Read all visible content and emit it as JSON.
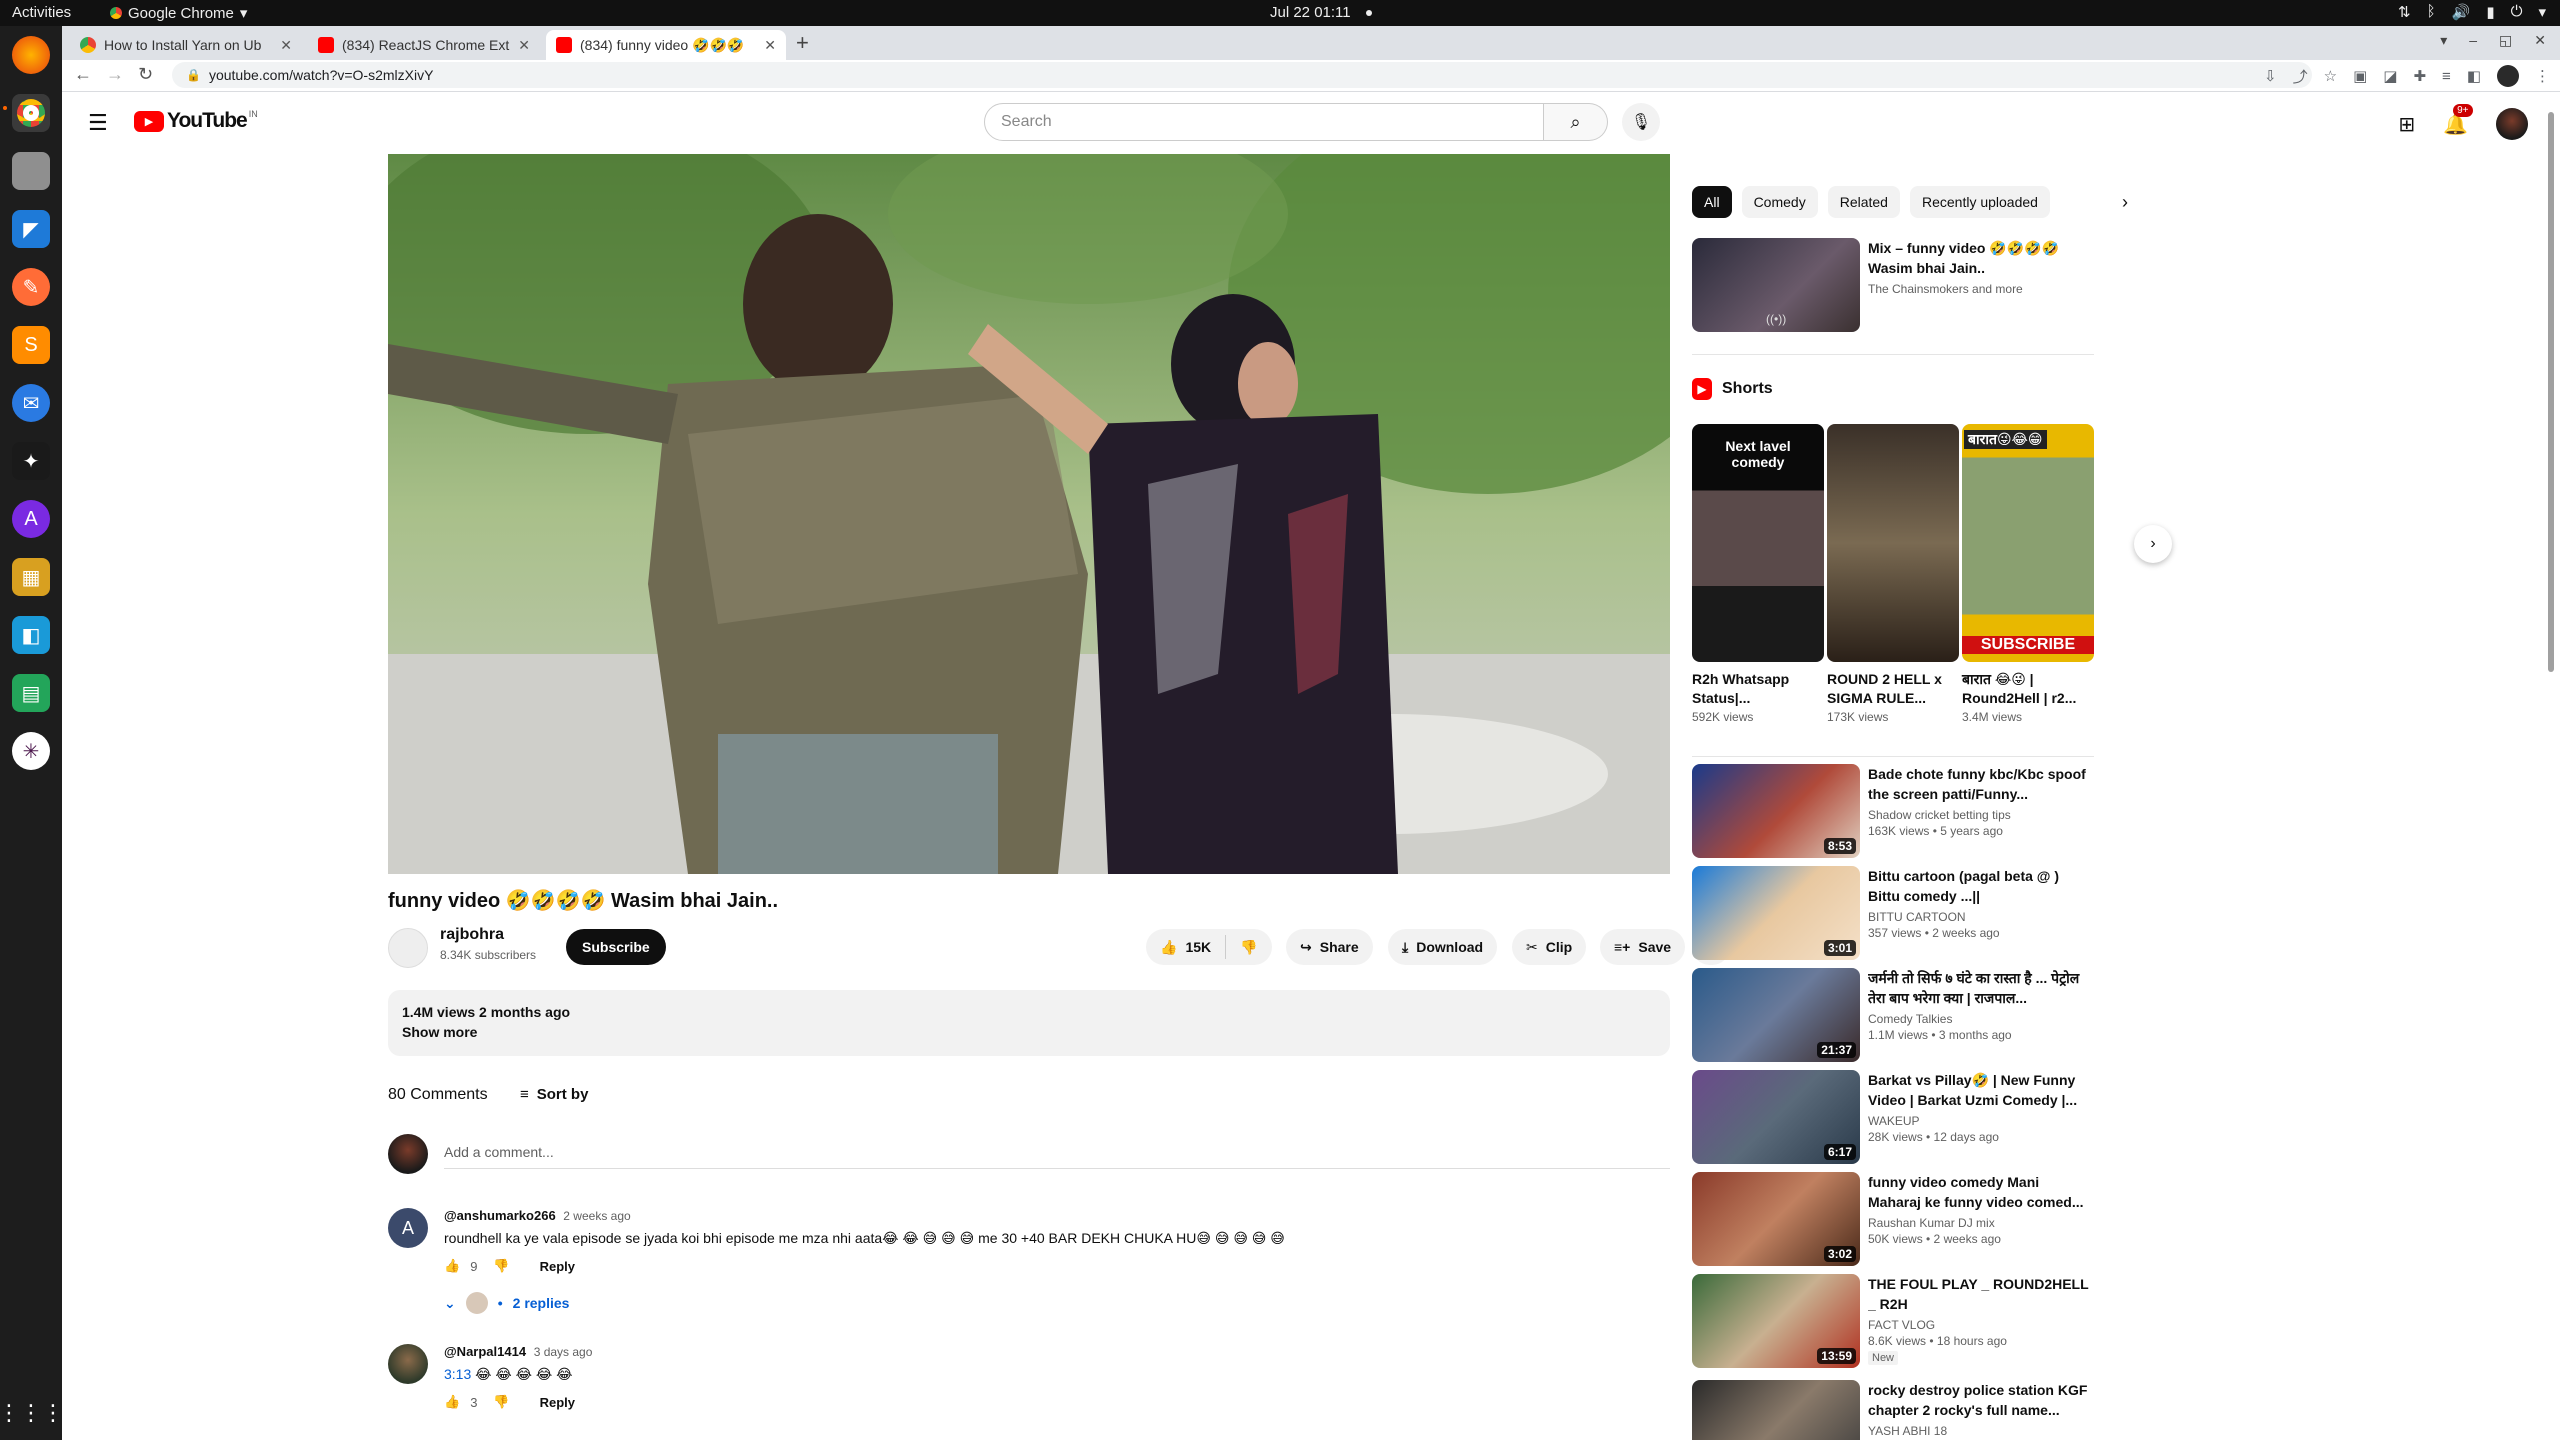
{
  "system": {
    "activities": "Activities",
    "app_menu": "Google Chrome",
    "clock": "Jul 22  01:11"
  },
  "browser": {
    "tabs": [
      {
        "title": "How to Install Yarn on Ub",
        "favicon": "chrome-icon"
      },
      {
        "title": "(834) ReactJS Chrome Ext",
        "favicon": "youtube-icon"
      },
      {
        "title": "(834) funny video 🤣🤣🤣",
        "favicon": "youtube-icon"
      }
    ],
    "url": "youtube.com/watch?v=O-s2mlzXivY"
  },
  "header": {
    "logo_text": "YouTube",
    "country": "IN",
    "search_placeholder": "Search",
    "notif_count": "9+"
  },
  "video": {
    "title": "funny video 🤣🤣🤣🤣 Wasim bhai Jain..",
    "channel": "rajbohra",
    "subscribers": "8.34K subscribers",
    "subscribe_label": "Subscribe",
    "likes": "15K",
    "share_label": "Share",
    "download_label": "Download",
    "clip_label": "Clip",
    "save_label": "Save",
    "views_date": "1.4M views  2 months ago",
    "show_more": "Show more"
  },
  "comments": {
    "count_label": "80 Comments",
    "sort_label": "Sort by",
    "add_placeholder": "Add a comment...",
    "items": [
      {
        "author": "@anshumarko266",
        "time": "2 weeks ago",
        "text": "roundhell ka ye vala episode se jyada koi bhi episode me mza nhi aata😂 😂 😅 😅 😅  me 30 +40 BAR DEKH CHUKA HU😅 😅 😅 😅 😅",
        "likes": "9",
        "reply_label": "Reply",
        "replies": "2 replies",
        "avatar_letter": "A"
      },
      {
        "author": "@Narpal1414",
        "time": "3 days ago",
        "timestamp_link": "3:13",
        "text": "😂 😂 😂 😂 😂",
        "likes": "3",
        "reply_label": "Reply"
      }
    ]
  },
  "sidebar": {
    "chips": [
      "All",
      "Comedy",
      "Related",
      "Recently uploaded"
    ],
    "mix": {
      "title": "Mix – funny video 🤣🤣🤣🤣 Wasim bhai Jain..",
      "channel": "The Chainsmokers and more"
    },
    "shorts_label": "Shorts",
    "shorts": [
      {
        "title": "R2h Whatsapp Status|...",
        "views": "592K views",
        "overlay": "Next lavel comedy"
      },
      {
        "title": "ROUND 2 HELL x SIGMA RULE...",
        "views": "173K views",
        "overlay": ""
      },
      {
        "title": "बारात 😂😜 | Round2Hell | r2...",
        "views": "3.4M views",
        "overlay": "बारात😜😂😁",
        "overlay2": "SUBSCRIBE"
      }
    ],
    "videos": [
      {
        "title": "Bade chote funny kbc/Kbc spoof the screen patti/Funny...",
        "channel": "Shadow cricket betting tips",
        "meta": "163K views • 5 years ago",
        "duration": "8:53"
      },
      {
        "title": "Bittu cartoon (pagal beta @ ) Bittu comedy ...||",
        "channel": "BITTU CARTOON",
        "meta": "357 views • 2 weeks ago",
        "duration": "3:01"
      },
      {
        "title": "जर्मनी तो सिर्फ ७ घंटे का रास्ता है ... पेट्रोल तेरा बाप भरेगा क्या | राजपाल...",
        "channel": "Comedy Talkies",
        "meta": "1.1M views • 3 months ago",
        "duration": "21:37"
      },
      {
        "title": "Barkat vs Pillay🤣 | New Funny Video | Barkat Uzmi Comedy |...",
        "channel": "WAKEUP",
        "meta": "28K views • 12 days ago",
        "duration": "6:17"
      },
      {
        "title": "funny video comedy Mani Maharaj ke funny video comed...",
        "channel": "Raushan Kumar DJ mix",
        "meta": "50K views • 2 weeks ago",
        "duration": "3:02"
      },
      {
        "title": "THE FOUL PLAY _ ROUND2HELL _ R2H",
        "channel": "FACT VLOG",
        "meta": "8.6K views • 18 hours ago",
        "duration": "13:59",
        "badge": "New"
      },
      {
        "title": "rocky destroy police station KGF chapter 2 rocky's full name...",
        "channel": "YASH ABHI 18",
        "meta": "",
        "duration": ""
      }
    ]
  }
}
